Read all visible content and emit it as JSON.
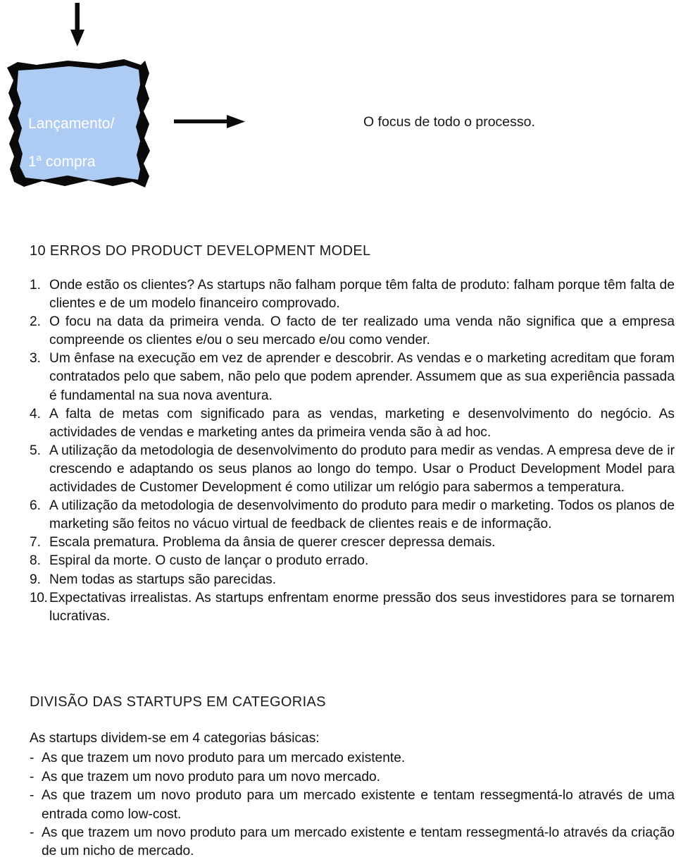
{
  "diagram": {
    "down_arrow": "down-arrow",
    "right_arrow": "right-arrow",
    "box": {
      "label_line1": "Lançamento/",
      "label_line2_prefix": "1",
      "label_line2_sup": "a",
      "label_line2_suffix": " compra",
      "fill_color": "#aecbf3",
      "border_color": "#000000",
      "text_color": "#ffffff"
    },
    "caption": "O focus de todo o processo."
  },
  "sections": {
    "erros": {
      "heading": "10 ERROS DO PRODUCT DEVELOPMENT MODEL",
      "items": [
        {
          "num": "1.",
          "text": "Onde estão os clientes? As startups não falham porque têm falta de produto: falham porque têm falta de clientes e de um modelo financeiro comprovado."
        },
        {
          "num": "2.",
          "text": "O focu na data da primeira venda. O facto de ter realizado uma venda não significa que a empresa compreende os clientes e/ou o seu mercado e/ou como vender."
        },
        {
          "num": "3.",
          "text": "Um ênfase na execução em vez de aprender e descobrir. As vendas e o marketing acreditam que foram contratados pelo que sabem, não pelo que podem aprender. Assumem que as sua experiência passada é fundamental na sua nova aventura."
        },
        {
          "num": "4.",
          "text": "A falta de metas com significado para as vendas, marketing e desenvolvimento do negócio. As actividades de vendas e marketing antes da primeira venda são à ad hoc."
        },
        {
          "num": "5.",
          "text": "A utilização da metodologia de desenvolvimento do produto para medir as vendas. A empresa deve de ir crescendo e adaptando os seus planos ao longo do tempo. Usar o Product Development Model para actividades de Customer Development é como utilizar um relógio para sabermos a temperatura."
        },
        {
          "num": "6.",
          "text": "A utilização da metodologia de desenvolvimento do produto para medir o marketing. Todos os planos de marketing são feitos no vácuo virtual de feedback de clientes reais e de informação."
        },
        {
          "num": "7.",
          "text": "Escala prematura. Problema da ânsia de querer crescer depressa demais."
        },
        {
          "num": "8.",
          "text": "Espiral da morte. O custo de lançar o produto errado."
        },
        {
          "num": "9.",
          "text": "Nem todas as startups são parecidas."
        },
        {
          "num": "10.",
          "text": "Expectativas irrealistas. As startups enfrentam enorme pressão dos seus investidores para se tornarem lucrativas."
        }
      ]
    },
    "divisao": {
      "heading": "DIVISÃO DAS STARTUPS EM CATEGORIAS",
      "intro": "As startups dividem-se em 4 categorias básicas:",
      "bullet_marker": "-",
      "items": [
        {
          "text": "As que trazem um novo produto para um mercado existente."
        },
        {
          "text": "As que trazem um novo produto para um novo mercado."
        },
        {
          "text": "As que trazem um novo produto para um mercado existente e tentam ressegmentá-lo através de uma entrada como low-cost."
        },
        {
          "text": "As que trazem um novo produto para um mercado existente e tentam ressegmentá-lo através da criação de um nicho de mercado."
        }
      ]
    }
  }
}
